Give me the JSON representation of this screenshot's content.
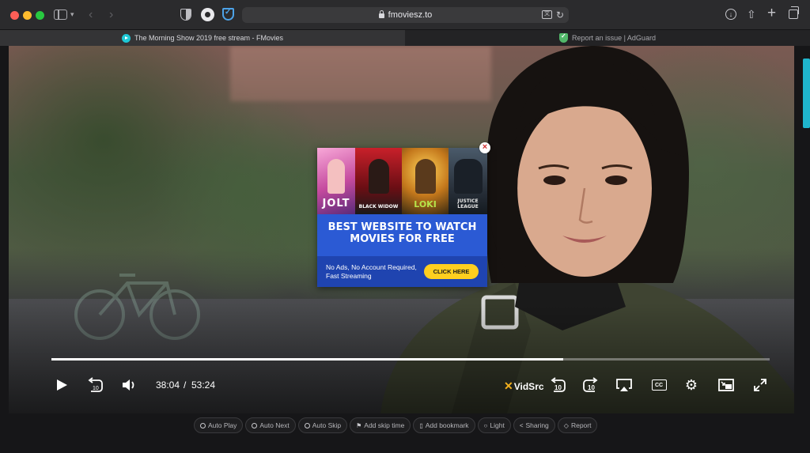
{
  "browser": {
    "url": "fmoviesz.to",
    "tabs": [
      {
        "label": "The Morning Show 2019 free stream - FMovies",
        "active": true
      },
      {
        "label": "Report an issue | AdGuard",
        "active": false
      }
    ],
    "colors": {
      "close": "#fe5f57",
      "minimize": "#febc2e",
      "zoom": "#28c840",
      "tab_favicon": "#1ec8d6",
      "adguard": "#52b86a"
    }
  },
  "ad": {
    "posters": [
      "JOLT",
      "BLACK WIDOW",
      "LOKI",
      "JUSTICE LEAGUE"
    ],
    "headline_line1": "BEST WEBSITE TO WATCH",
    "headline_line2": "MOVIES FOR FREE",
    "subtext": "No Ads, No Account Required, Fast Streaming",
    "cta": "CLICK HERE",
    "close_icon": "×",
    "colors": {
      "background": "#2b5ad4",
      "cta": "#ffcf1f"
    }
  },
  "player": {
    "current_time": "38:04",
    "separator": "/",
    "duration": "53:24",
    "progress_fraction": 0.713,
    "brand_mark": "✕",
    "brand": "VidSrc",
    "rewind_seconds": "10",
    "forward_seconds": "10",
    "cc_label": "CC"
  },
  "actions": [
    {
      "label": "Auto Play",
      "icon": "radio-icon"
    },
    {
      "label": "Auto Next",
      "icon": "radio-icon"
    },
    {
      "label": "Auto Skip",
      "icon": "radio-icon"
    },
    {
      "label": "Add skip time",
      "icon": "flag-icon"
    },
    {
      "label": "Add bookmark",
      "icon": "bookmark-icon"
    },
    {
      "label": "Light",
      "icon": "bulb-icon"
    },
    {
      "label": "Sharing",
      "icon": "share-icon"
    },
    {
      "label": "Report",
      "icon": "report-icon"
    }
  ]
}
